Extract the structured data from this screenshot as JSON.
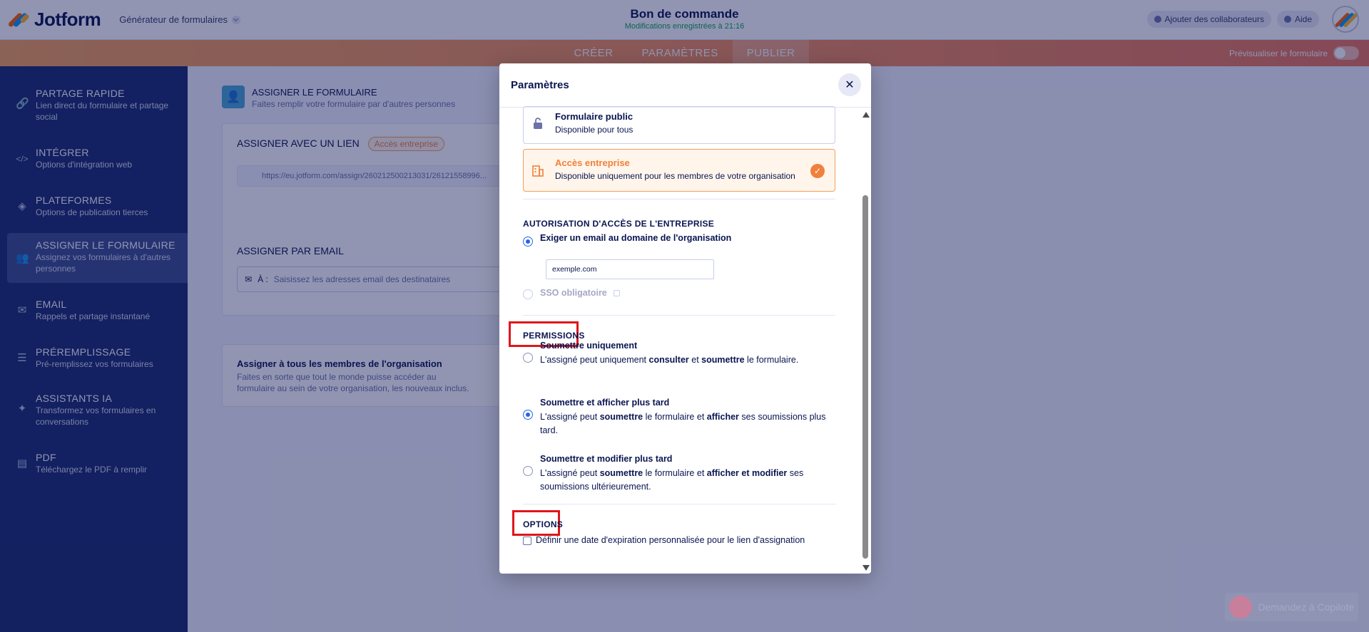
{
  "header": {
    "logo": "Jotform",
    "builder_switch": "Générateur de formulaires",
    "form_title": "Bon de commande",
    "saved_status": "Modifications enregistrées à 21:16",
    "add_collaborators": "Ajouter des collaborateurs",
    "help": "Aide"
  },
  "tabs": {
    "create": "CRÉER",
    "settings": "PARAMÈTRES",
    "publish": "PUBLIER",
    "preview_label": "Prévisualiser le formulaire"
  },
  "sidebar": {
    "items": [
      {
        "title": "PARTAGE RAPIDE",
        "sub": "Lien direct du formulaire et partage social"
      },
      {
        "title": "INTÉGRER",
        "sub": "Options d'intégration web"
      },
      {
        "title": "PLATEFORMES",
        "sub": "Options de publication tierces"
      },
      {
        "title": "ASSIGNER LE FORMULAIRE",
        "sub": "Assignez vos formulaires à d'autres personnes"
      },
      {
        "title": "EMAIL",
        "sub": "Rappels et partage instantané"
      },
      {
        "title": "PRÉREMPLISSAGE",
        "sub": "Pré-remplissez vos formulaires"
      },
      {
        "title": "ASSISTANTS IA",
        "sub": "Transformez vos formulaires en conversations"
      },
      {
        "title": "PDF",
        "sub": "Téléchargez le PDF à remplir"
      }
    ]
  },
  "main": {
    "heading": "ASSIGNER LE FORMULAIRE",
    "subheading": "Faites remplir votre formulaire par d'autres personnes",
    "link_section_title": "ASSIGNER AVEC UN LIEN",
    "link_badge": "Accès entreprise",
    "link_url": "https://eu.jotform.com/assign/260212500213031/26121558996...",
    "email_section_title": "ASSIGNER PAR EMAIL",
    "email_to_label": "À :",
    "email_placeholder": "Saisissez les adresses email des destinataires",
    "org_title": "Assigner à tous les membres de l'organisation",
    "org_desc": "Faites en sorte que tout le monde puisse accéder au formulaire au sein de votre organisation, les nouveaux inclus."
  },
  "modal": {
    "title": "Paramètres",
    "public_title": "Formulaire public",
    "public_sub": "Disponible pour tous",
    "enterprise_title": "Accès entreprise",
    "enterprise_sub": "Disponible uniquement pour les membres de votre organisation",
    "auth_title": "AUTORISATION D'ACCÈS DE L'ENTREPRISE",
    "require_email_label": "Exiger un email au domaine de l'organisation",
    "domain_value": "exemple.com",
    "sso_label": "SSO obligatoire",
    "permissions_title": "PERMISSIONS",
    "perm1_title": "Soumettre uniquement",
    "perm1_a": "L'assigné peut uniquement ",
    "perm1_b": "consulter",
    "perm1_c": " et ",
    "perm1_d": "soumettre",
    "perm1_e": " le formulaire.",
    "perm2_title": "Soumettre et afficher plus tard",
    "perm2_a": "L'assigné peut ",
    "perm2_b": "soumettre",
    "perm2_c": " le formulaire et ",
    "perm2_d": "afficher",
    "perm2_e": " ses soumissions plus tard.",
    "perm3_title": "Soumettre et modifier plus tard",
    "perm3_a": "L'assigné peut ",
    "perm3_b": "soumettre",
    "perm3_c": " le formulaire et ",
    "perm3_d": "afficher et modifier",
    "perm3_e": " ses soumissions ultérieurement.",
    "options_title": "OPTIONS",
    "expiry_label": "Définir une date d'expiration personnalisée pour le lien d'assignation"
  },
  "copilot": {
    "label": "Demandez à Copilote"
  },
  "colors": {
    "accent_orange": "#f0803c",
    "sidebar_bg": "#1a2b6d",
    "radio_blue": "#2563eb",
    "highlight_red": "#e0161a"
  }
}
